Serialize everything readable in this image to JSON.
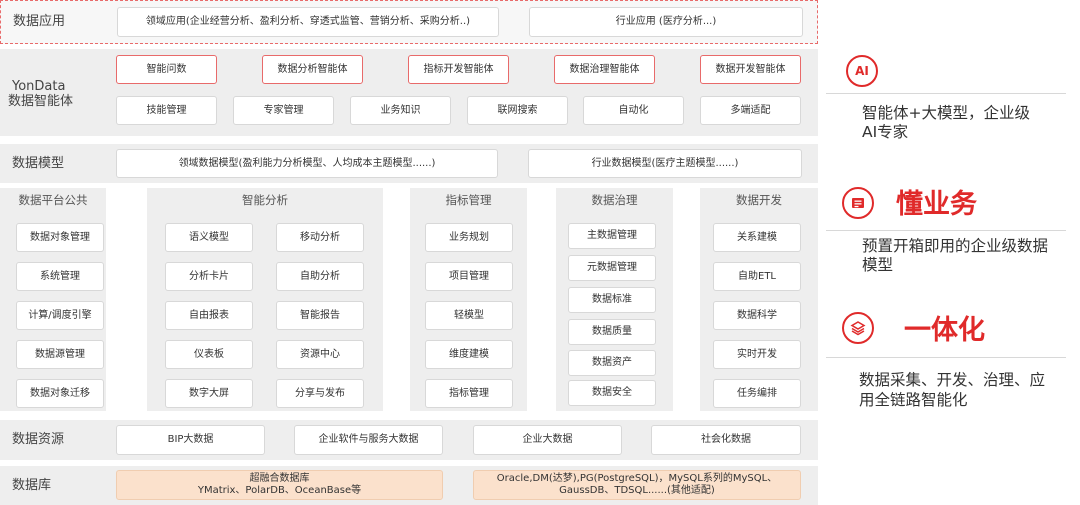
{
  "app_layer": {
    "label": "数据应用",
    "domain_apps": "领域应用(企业经营分析、盈利分析、穿透式监管、营销分析、采购分析..)",
    "industry_apps": "行业应用 (医疗分析...)"
  },
  "agent_layer": {
    "label_line1": "YonData",
    "label_line2": "数据智能体",
    "agents": [
      "智能问数",
      "数据分析智能体",
      "指标开发智能体",
      "数据治理智能体",
      "数据开发智能体"
    ],
    "capabilities": [
      "技能管理",
      "专家管理",
      "业务知识",
      "联网搜索",
      "自动化",
      "多端适配"
    ]
  },
  "model_layer": {
    "label": "数据模型",
    "domain_models": "领域数据模型(盈利能力分析模型、人均成本主题模型......)",
    "industry_models": "行业数据模型(医疗主题模型......)"
  },
  "platform": {
    "common": {
      "title": "数据平台公共",
      "items": [
        "数据对象管理",
        "系统管理",
        "计算/调度引擎",
        "数据源管理",
        "数据对象迁移"
      ]
    },
    "analysis": {
      "title": "智能分析",
      "left": [
        "语义模型",
        "分析卡片",
        "自由报表",
        "仪表板",
        "数字大屏"
      ],
      "right": [
        "移动分析",
        "自助分析",
        "智能报告",
        "资源中心",
        "分享与发布"
      ]
    },
    "metrics": {
      "title": "指标管理",
      "items": [
        "业务规划",
        "项目管理",
        "轻模型",
        "维度建模",
        "指标管理"
      ]
    },
    "governance": {
      "title": "数据治理",
      "items": [
        "主数据管理",
        "元数据管理",
        "数据标准",
        "数据质量",
        "数据资产",
        "数据安全"
      ]
    },
    "development": {
      "title": "数据开发",
      "items": [
        "关系建模",
        "自助ETL",
        "数据科学",
        "实时开发",
        "任务编排"
      ]
    }
  },
  "resource_layer": {
    "label": "数据资源",
    "items": [
      "BIP大数据",
      "企业软件与服务大数据",
      "企业大数据",
      "社会化数据"
    ]
  },
  "db_layer": {
    "label": "数据库",
    "left_line1": "超融合数据库",
    "left_line2": "YMatrix、PolarDB、OceanBase等",
    "right_line1": "Oracle,DM(达梦),PG(PostgreSQL)，MySQL系列的MySQL、",
    "right_line2": "GaussDB、TDSQL......(其他适配)"
  },
  "right_panel": {
    "ai": {
      "icon_text": "AI",
      "text_line1": "智能体+大模型，企业级",
      "text_line2": "AI专家"
    },
    "business": {
      "icon": "document-icon",
      "heading": "懂业务",
      "text_line1": "预置开箱即用的企业级数据",
      "text_line2": "模型"
    },
    "integrated": {
      "icon": "layers-icon",
      "heading": "一体化",
      "text_line1": "数据采集、开发、治理、应",
      "text_line2": "用全链路智能化"
    }
  },
  "colors": {
    "accent_red": "#e02a2a",
    "box_border_red": "#e86a6a",
    "db_fill": "#fbe1cc",
    "band_gray": "#eeeeee"
  }
}
